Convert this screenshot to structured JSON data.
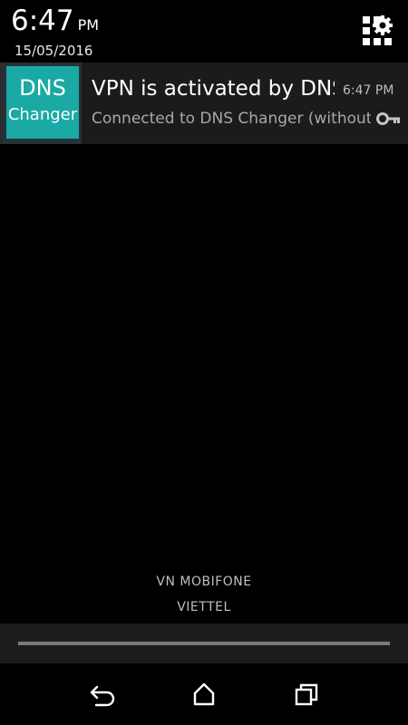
{
  "status_header": {
    "time": "6:47",
    "ampm": "PM",
    "date": "15/05/2016",
    "settings_icon": "quick-settings-grid-icon"
  },
  "notification": {
    "app_icon": {
      "line1": "DNS",
      "line2": "Changer",
      "color": "#1aa9a4"
    },
    "title": "VPN is activated by DNS Changer",
    "time": "6:47 PM",
    "text": "Connected to DNS Changer (without root)",
    "status_icon": "key-icon"
  },
  "carriers": [
    "VN MOBIFONE",
    "VIETTEL"
  ],
  "nav": {
    "back_icon": "back-arrow-icon",
    "home_icon": "home-icon",
    "recents_icon": "recents-icon"
  }
}
